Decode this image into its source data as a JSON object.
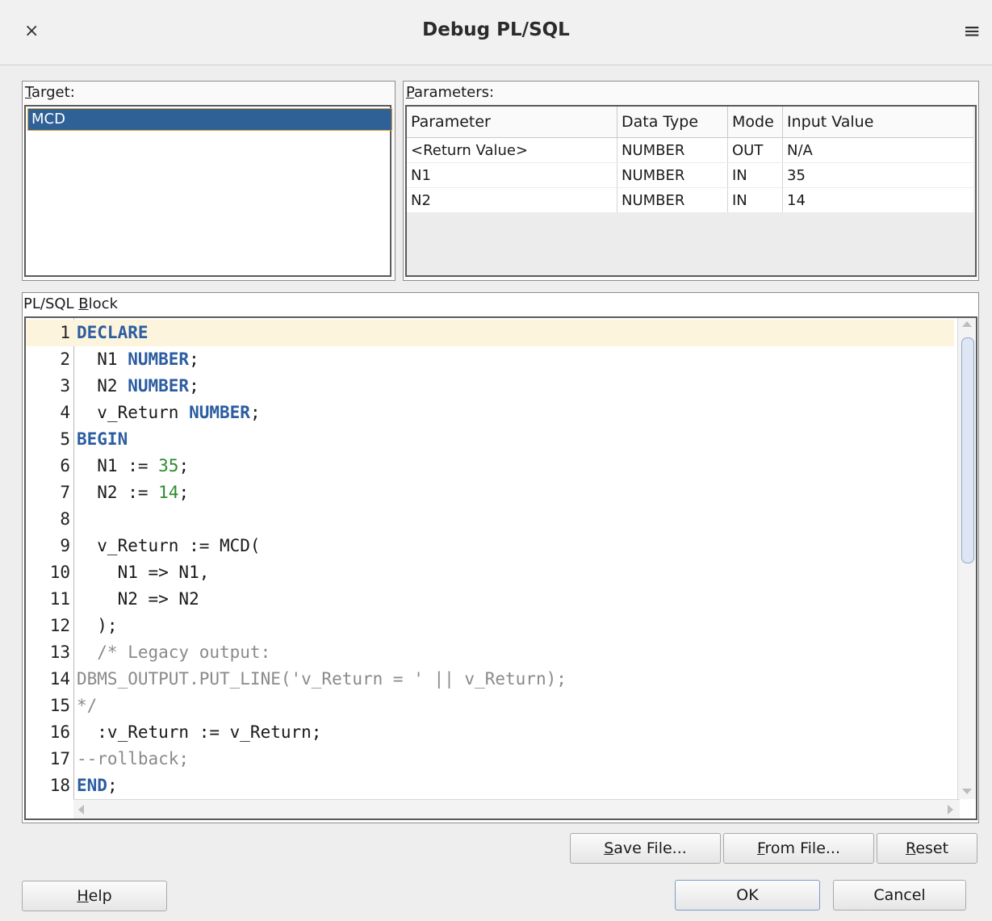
{
  "window": {
    "title": "Debug PL/SQL",
    "close_glyph": "×",
    "menu_glyph": "≡"
  },
  "target": {
    "label_mnemonic": "T",
    "label_rest": "arget:",
    "items": [
      "MCD"
    ]
  },
  "parameters": {
    "label_mnemonic": "P",
    "label_rest": "arameters:",
    "columns": [
      "Parameter",
      "Data Type",
      "Mode",
      "Input Value"
    ],
    "rows": [
      [
        "<Return Value>",
        "NUMBER",
        "OUT",
        "N/A"
      ],
      [
        "N1",
        "NUMBER",
        "IN",
        "35"
      ],
      [
        "N2",
        "NUMBER",
        "IN",
        "14"
      ]
    ]
  },
  "block": {
    "label_pre": "PL/SQL ",
    "label_mnemonic": "B",
    "label_rest": "lock",
    "lines": [
      {
        "n": "1",
        "code": "DECLARE"
      },
      {
        "n": "2",
        "code": "  N1 NUMBER;"
      },
      {
        "n": "3",
        "code": "  N2 NUMBER;"
      },
      {
        "n": "4",
        "code": "  v_Return NUMBER;"
      },
      {
        "n": "5",
        "code": "BEGIN"
      },
      {
        "n": "6",
        "code": "  N1 := 35;"
      },
      {
        "n": "7",
        "code": "  N2 := 14;"
      },
      {
        "n": "8",
        "code": ""
      },
      {
        "n": "9",
        "code": "  v_Return := MCD("
      },
      {
        "n": "10",
        "code": "    N1 => N1,"
      },
      {
        "n": "11",
        "code": "    N2 => N2"
      },
      {
        "n": "12",
        "code": "  );"
      },
      {
        "n": "13",
        "code": "  /* Legacy output:"
      },
      {
        "n": "14",
        "code": "DBMS_OUTPUT.PUT_LINE('v_Return = ' || v_Return);"
      },
      {
        "n": "15",
        "code": "*/"
      },
      {
        "n": "16",
        "code": "  :v_Return := v_Return;"
      },
      {
        "n": "17",
        "code": "--rollback;"
      },
      {
        "n": "18",
        "code": "END;"
      }
    ]
  },
  "buttons": {
    "save_file": {
      "mn": "S",
      "rest": "ave File..."
    },
    "from_file": {
      "mn": "F",
      "rest": "rom File..."
    },
    "reset": {
      "mn": "R",
      "rest": "eset"
    },
    "help": {
      "mn": "H",
      "rest": "elp"
    },
    "ok": "OK",
    "cancel": "Cancel"
  }
}
